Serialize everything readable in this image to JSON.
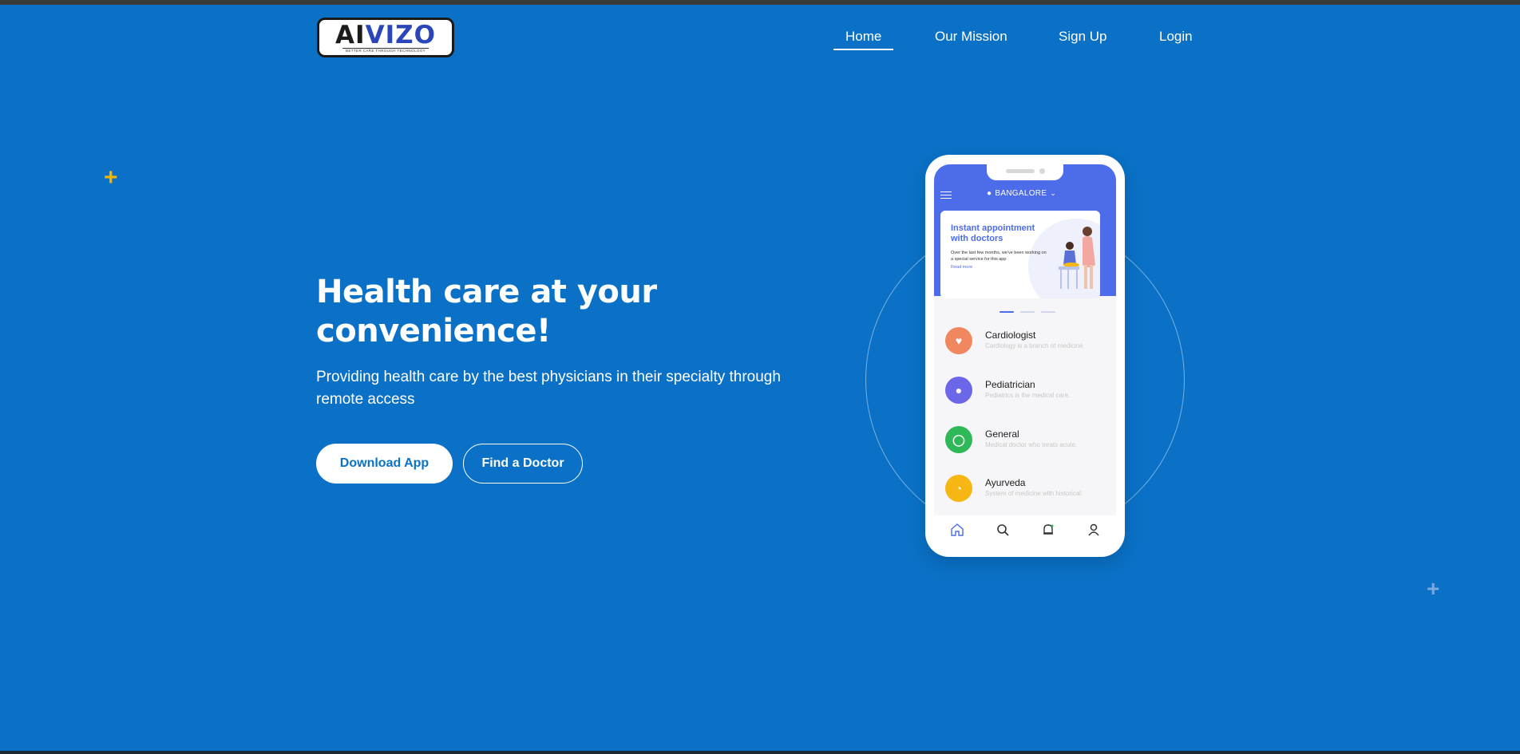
{
  "brand": {
    "logo_word_part1": "AI",
    "logo_word_part2": "VIZO",
    "logo_tagline": "BETTER CARE THROUGH TECHNOLOGY"
  },
  "nav": {
    "items": [
      {
        "label": "Home",
        "active": true
      },
      {
        "label": "Our Mission",
        "active": false
      },
      {
        "label": "Sign Up",
        "active": false
      },
      {
        "label": "Login",
        "active": false
      }
    ]
  },
  "hero": {
    "title_line1": "Health care at your",
    "title_line2": "convenience!",
    "subtitle": "Providing health care by the best physicians in their specialty through remote access",
    "primary_button": "Download App",
    "secondary_button": "Find a Doctor"
  },
  "phone": {
    "location": "BANGALORE",
    "promo": {
      "title": "Instant appointment with doctors",
      "text": "Over the last few months, we've been working on a special service for this app",
      "link": "Read more"
    },
    "specialties": [
      {
        "name": "Cardiologist",
        "desc": "Cardiology is a branch of medicine.",
        "color": "#f0875e",
        "icon": "heart-icon"
      },
      {
        "name": "Pediatrician",
        "desc": "Pediatrics is the medical care.",
        "color": "#6b67e8",
        "icon": "child-icon"
      },
      {
        "name": "General",
        "desc": "Medical doctor who treats acute.",
        "color": "#2fb857",
        "icon": "stethoscope-icon"
      },
      {
        "name": "Ayurveda",
        "desc": "System of medicine with historical.",
        "color": "#f6b714",
        "icon": "mortar-icon"
      }
    ],
    "tabs": [
      "home-icon",
      "search-icon",
      "bell-icon",
      "user-icon"
    ]
  },
  "colors": {
    "background": "#0a71c6",
    "phone_header": "#4c6cea",
    "accent_plus": "#f5b400"
  }
}
